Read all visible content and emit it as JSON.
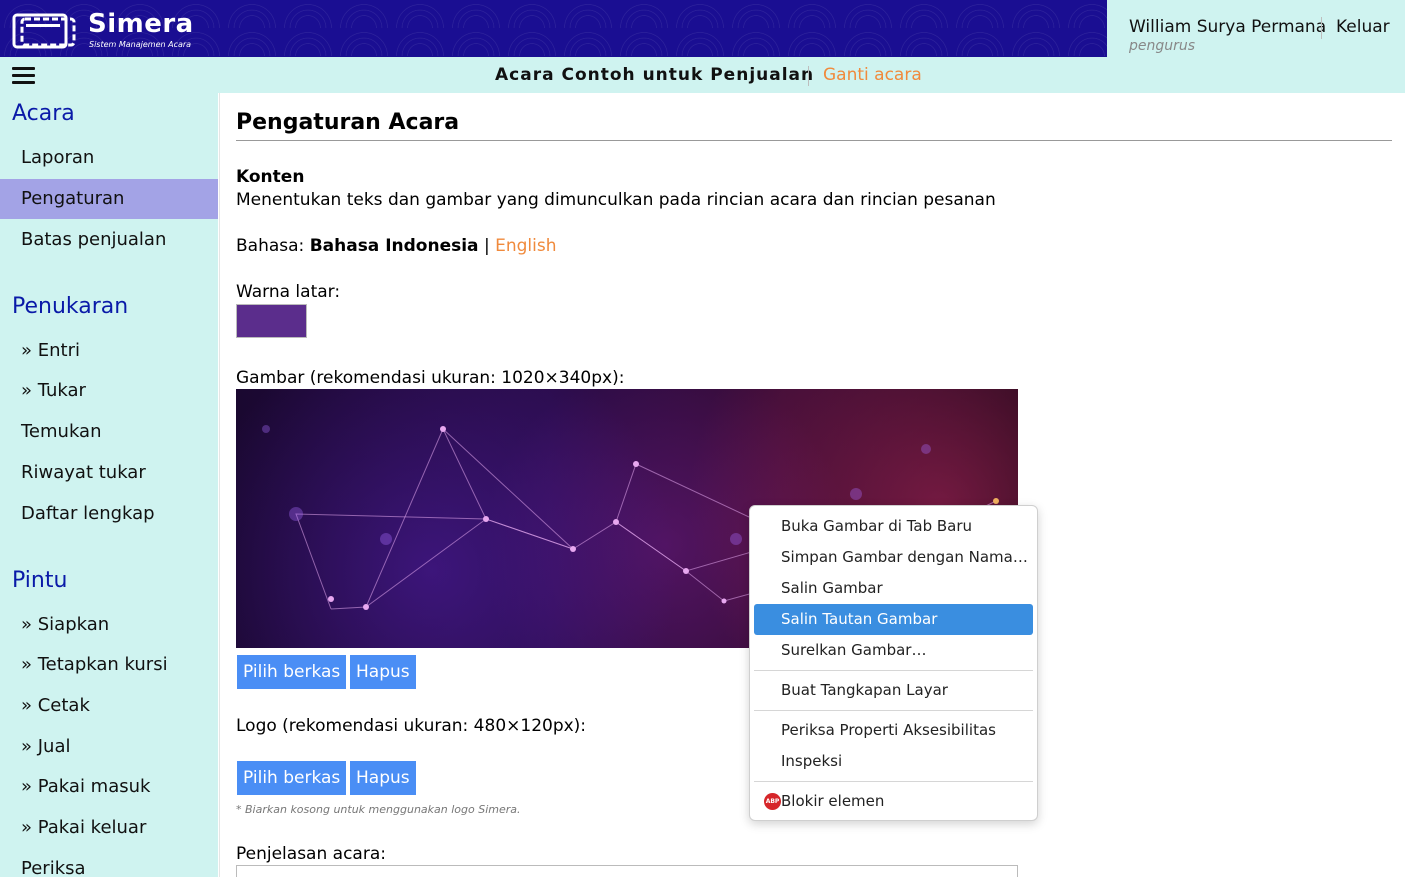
{
  "header": {
    "app_name": "Simera",
    "app_subtitle": "Sistem Manajemen Acara",
    "user_name": "William Surya Permana",
    "user_role": "pengurus",
    "logout_label": "Keluar"
  },
  "subbar": {
    "event_name": "Acara Contoh untuk Penjualan",
    "change_event_label": "Ganti acara"
  },
  "sidebar": {
    "sections": [
      {
        "title": "Acara",
        "items": [
          "Laporan",
          "Pengaturan",
          "Batas penjualan"
        ]
      },
      {
        "title": "Penukaran",
        "items": [
          "» Entri",
          "» Tukar",
          "Temukan",
          "Riwayat tukar",
          "Daftar lengkap"
        ]
      },
      {
        "title": "Pintu",
        "items": [
          "» Siapkan",
          "» Tetapkan kursi",
          "» Cetak",
          "» Jual",
          "» Pakai masuk",
          "» Pakai keluar",
          "Periksa"
        ]
      }
    ],
    "active_item": "Pengaturan"
  },
  "main": {
    "title": "Pengaturan Acara",
    "section_title": "Konten",
    "section_desc": "Menentukan teks dan gambar yang dimunculkan pada rincian acara dan rincian pesanan",
    "language_label": "Bahasa:",
    "language_current": "Bahasa Indonesia",
    "language_sep": "|",
    "language_other": "English",
    "bg_color_label": "Warna latar:",
    "bg_color": "#5b2d8c",
    "image_label": "Gambar (rekomendasi ukuran: 1020×340px):",
    "choose_file_label": "Pilih berkas",
    "delete_label": "Hapus",
    "logo_label": "Logo (rekomendasi ukuran: 480×120px):",
    "logo_note": "* Biarkan kosong untuk menggunakan logo Simera.",
    "description_label": "Penjelasan acara:"
  },
  "context_menu": {
    "items": [
      "Buka Gambar di Tab Baru",
      "Simpan Gambar dengan Nama…",
      "Salin Gambar",
      "Salin Tautan Gambar",
      "Surelkan Gambar…",
      "Buat Tangkapan Layar",
      "Periksa Properti Aksesibilitas",
      "Inspeksi",
      "Blokir elemen"
    ],
    "highlighted": "Salin Tautan Gambar",
    "abp_badge": "ABP"
  },
  "colors": {
    "header_bg": "#1a0e92",
    "panel_bg": "#cff3f0",
    "active_bg": "#a3a3e6",
    "link": "#f08a3c",
    "section_title": "#0a1aa8",
    "button": "#4a8ef5",
    "menu_highlight": "#3a8ee0"
  }
}
